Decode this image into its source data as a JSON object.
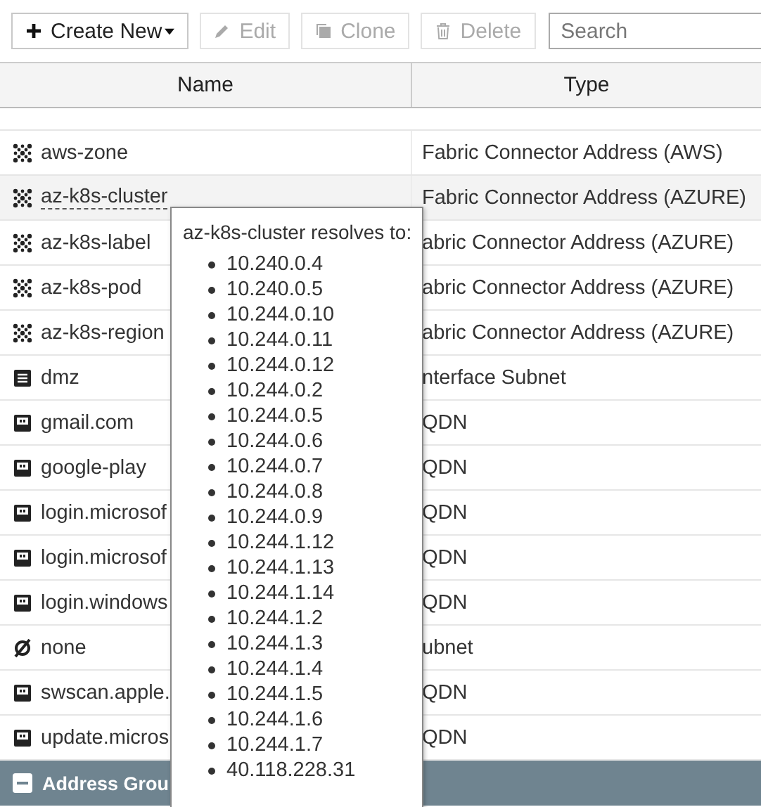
{
  "toolbar": {
    "buttons": [
      {
        "label": "Create New",
        "kind": "create",
        "disabled": false
      },
      {
        "label": "Edit",
        "kind": "edit",
        "disabled": true
      },
      {
        "label": "Clone",
        "kind": "clone",
        "disabled": true
      },
      {
        "label": "Delete",
        "kind": "delete",
        "disabled": true
      }
    ],
    "search": {
      "placeholder": "Search"
    }
  },
  "table": {
    "columns": [
      "Name",
      "Type"
    ],
    "rows": [
      {
        "kind": "connector",
        "name": "aws-zone",
        "type": "Fabric Connector Address (AWS)",
        "highlighted": false
      },
      {
        "kind": "connector",
        "name": "az-k8s-cluster",
        "type": "Fabric Connector Address (AZURE)",
        "highlighted": true
      },
      {
        "kind": "connector",
        "name": "az-k8s-label",
        "type": "abric Connector Address (AZURE)",
        "highlighted": false
      },
      {
        "kind": "connector",
        "name": "az-k8s-pod",
        "type": "abric Connector Address (AZURE)",
        "highlighted": false
      },
      {
        "kind": "connector",
        "name": "az-k8s-region",
        "type": "abric Connector Address (AZURE)",
        "highlighted": false
      },
      {
        "kind": "subnet",
        "name": "dmz",
        "type": "nterface Subnet",
        "highlighted": false
      },
      {
        "kind": "fqdn",
        "name": "gmail.com",
        "type": "QDN",
        "highlighted": false
      },
      {
        "kind": "fqdn",
        "name": "google-play",
        "type": "QDN",
        "highlighted": false
      },
      {
        "kind": "fqdn",
        "name": "login.microsof",
        "type": "QDN",
        "highlighted": false
      },
      {
        "kind": "fqdn",
        "name": "login.microsof",
        "type": "QDN",
        "highlighted": false
      },
      {
        "kind": "fqdn",
        "name": "login.windows",
        "type": "QDN",
        "highlighted": false
      },
      {
        "kind": "none",
        "name": "none",
        "type": "ubnet",
        "highlighted": false
      },
      {
        "kind": "fqdn",
        "name": "swscan.apple.",
        "type": "QDN",
        "highlighted": false
      },
      {
        "kind": "fqdn",
        "name": "update.micros",
        "type": "QDN",
        "highlighted": false
      }
    ],
    "group": {
      "label": "Address Grou",
      "expanded": true
    }
  },
  "tooltip": {
    "title": "az-k8s-cluster resolves to:",
    "items": [
      "10.240.0.4",
      "10.240.0.5",
      "10.244.0.10",
      "10.244.0.11",
      "10.244.0.12",
      "10.244.0.2",
      "10.244.0.5",
      "10.244.0.6",
      "10.244.0.7",
      "10.244.0.8",
      "10.244.0.9",
      "10.244.1.12",
      "10.244.1.13",
      "10.244.1.14",
      "10.244.1.2",
      "10.244.1.3",
      "10.244.1.4",
      "10.244.1.5",
      "10.244.1.6",
      "10.244.1.7",
      "40.118.228.31"
    ]
  }
}
